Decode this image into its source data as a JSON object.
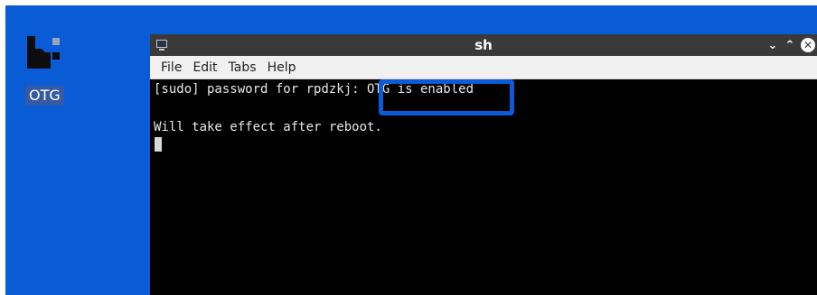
{
  "desktop": {
    "icon": {
      "icon_name": "otg-app-icon",
      "label": "OTG"
    },
    "background_color": "#0a5bd6"
  },
  "window": {
    "title": "sh",
    "app_icon": "terminal-icon",
    "controls": {
      "minimize_icon": "chevron-down-icon",
      "maximize_icon": "chevron-up-icon",
      "close_icon": "close-icon"
    },
    "menu": [
      "File",
      "Edit",
      "Tabs",
      "Help"
    ]
  },
  "terminal": {
    "lines": [
      "[sudo] password for rpdzkj: OTG is enabled",
      "",
      "Will take effect after reboot."
    ]
  },
  "annotation": {
    "highlight_color": "#0b5ad7",
    "highlighted_text": "OTG is enabled"
  }
}
